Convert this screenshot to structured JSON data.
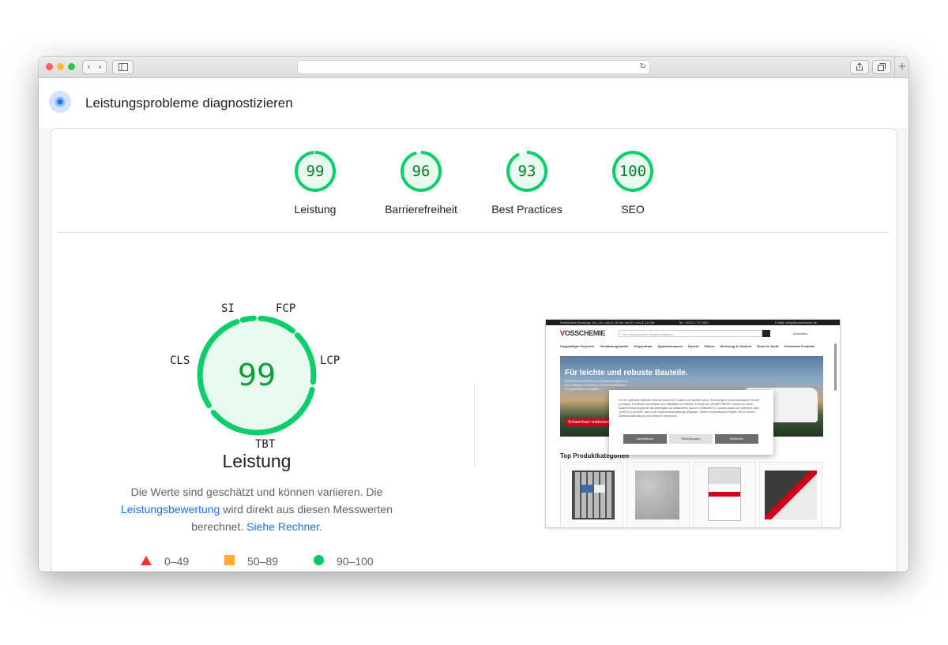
{
  "browser": {
    "back_icon": "chevron-left-icon",
    "forward_icon": "chevron-right-icon",
    "reload_icon": "reload-icon",
    "back_glyph": "‹",
    "forward_glyph": "›",
    "reload_glyph": "↻",
    "new_tab_glyph": "+"
  },
  "header": {
    "title": "Leistungsprobleme diagnostizieren",
    "logo_icon": "lighthouse-icon"
  },
  "scores": [
    {
      "value": "99",
      "label": "Leistung",
      "score": 99
    },
    {
      "value": "96",
      "label": "Barrierefreiheit",
      "score": 96
    },
    {
      "value": "93",
      "label": "Best Practices",
      "score": 93
    },
    {
      "value": "100",
      "label": "SEO",
      "score": 100
    }
  ],
  "performance": {
    "score": "99",
    "title": "Leistung",
    "metrics": [
      "SI",
      "FCP",
      "LCP",
      "TBT",
      "CLS"
    ],
    "description_before": "Die Werte sind geschätzt und können variieren. Die ",
    "link1": "Leistungsbewertung",
    "description_middle": " wird direkt aus diesen Messwerten berechnet. ",
    "link2": "Siehe Rechner",
    "description_after": "."
  },
  "legend": [
    {
      "range": "0–49",
      "shape": "triangle",
      "color": "#ff3333"
    },
    {
      "range": "50–89",
      "shape": "square",
      "color": "#ffaa33"
    },
    {
      "range": "90–100",
      "shape": "circle",
      "color": "#00cc66"
    }
  ],
  "colors": {
    "pass": "#0cce6b",
    "pass_bg": "#e8f9ef",
    "pass_text": "#0a7f2a"
  },
  "screenshot": {
    "logo_a": "V",
    "logo_b": "OSSCHEMIE",
    "search_placeholder": "Hier den gesuchten Begriff eingeben",
    "topbar_left": "Persönliche Beratung: Mo.–Do. von 8–16 Uhr und Fr. von 8–14 Uhr",
    "topbar_mid": "Tel.: 04122 / 717-600",
    "topbar_right": "E-Mail: shop@vosschemie.de",
    "account": "Anmelden",
    "nav": [
      "Ungesättigte Polyester",
      "Verstärkungsmittel",
      "Polyurethan",
      "Spachtelmassen",
      "Epoxid",
      "Silikon",
      "Werkzeug & Zubehör",
      "Boots & Yacht",
      "Gemischte Produkte"
    ],
    "hero_title": "Für leichte und robuste Bauteile.",
    "hero_sub": "Mit leichten Harzstoffen und Glasfaserprodukten für den Leichtbau im Caravan- und Reisemobilsektor. Für Spezialisten wie Bastler.",
    "hero_button": "Schaumharz entdecken",
    "cookie_text": "Für ein optimales Website-Erlebnis nutzen wir Cookies und weitere Online-Technologien um personalisierte Inhalte zu zeigen, Funktionen anzubieten und Statistiken zu erheben. Ihr Klick auf „AKZEPTIEREN“ erlaubt uns diese Datenverarbeitung sowie die Weitergabe an Drittanbieter (auch in Drittländern). Cookies lassen sich jederzeit unter „EINSTELLUNGEN“ oder in der Datenschutzerklärung anpassen. Weitere Informationen erhalten Sie in unserer Datenschutzerklärung und unserem Impressum.",
    "cookie_buttons": [
      "Akzeptieren",
      "Einstellungen",
      "Ablehnen"
    ],
    "section_title": "Top Produktkategorien"
  }
}
